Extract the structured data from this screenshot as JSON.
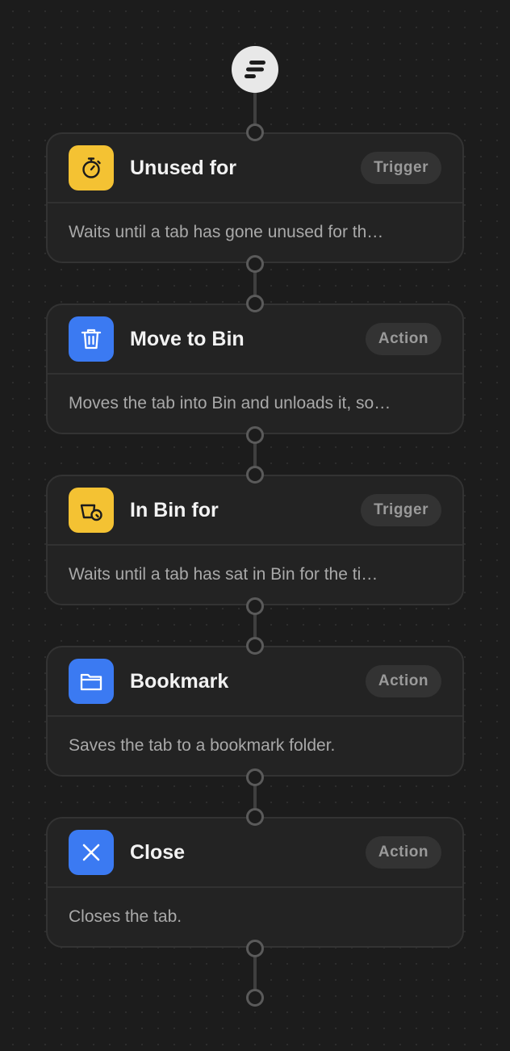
{
  "workflow": {
    "start_icon": "flow-start-icon",
    "steps": [
      {
        "title": "Unused for",
        "badge": "Trigger",
        "description": "Waits until a tab has gone unused for th…",
        "icon": "stopwatch-icon",
        "color": "#f4c233"
      },
      {
        "title": "Move to Bin",
        "badge": "Action",
        "description": "Moves the tab into Bin and unloads it, so…",
        "icon": "trash-icon",
        "color": "#3b7af2"
      },
      {
        "title": "In Bin for",
        "badge": "Trigger",
        "description": "Waits until a tab has sat in Bin for the ti…",
        "icon": "bin-timer-icon",
        "color": "#f4c233"
      },
      {
        "title": "Bookmark",
        "badge": "Action",
        "description": "Saves the tab to a bookmark folder.",
        "icon": "folder-icon",
        "color": "#3b7af2"
      },
      {
        "title": "Close",
        "badge": "Action",
        "description": "Closes the tab.",
        "icon": "close-x-icon",
        "color": "#3b7af2"
      }
    ]
  }
}
